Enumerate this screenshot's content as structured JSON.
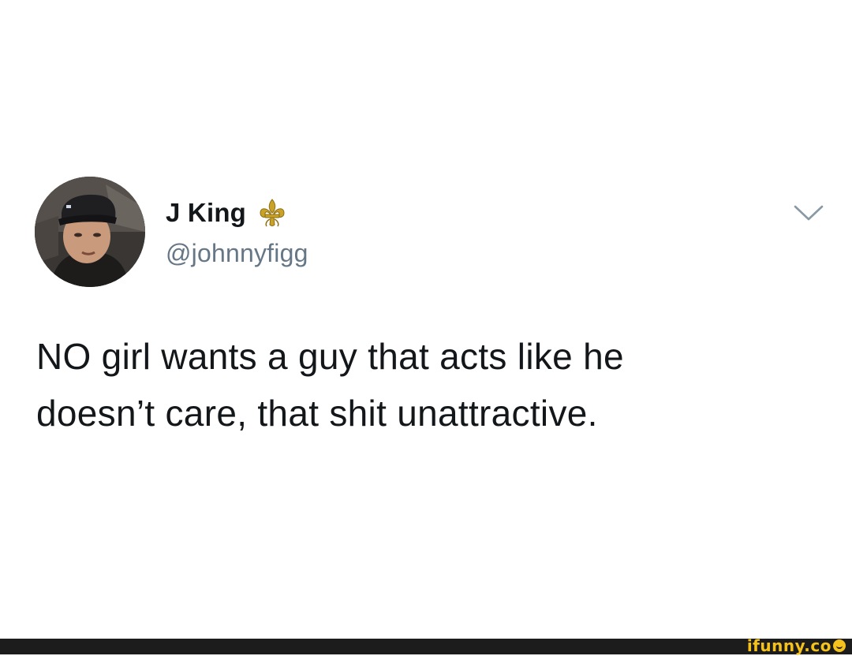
{
  "tweet": {
    "display_name": "J King",
    "handle": "@johnnyfigg",
    "badge_icon": "fleur-de-lis-icon",
    "menu_icon": "chevron-down-icon",
    "text_lines": [
      "NO girl wants a guy that acts like he",
      "doesn’t care, that shit unattractive."
    ]
  },
  "footer": {
    "watermark_text": "ifunny.co",
    "watermark_icon": "smiley-icon",
    "watermark_color": "#f5c21b",
    "bar_color": "#1c1c1c"
  },
  "colors": {
    "name_text": "#14171a",
    "handle_text": "#657786",
    "body_text": "#14171a",
    "background": "#ffffff"
  }
}
